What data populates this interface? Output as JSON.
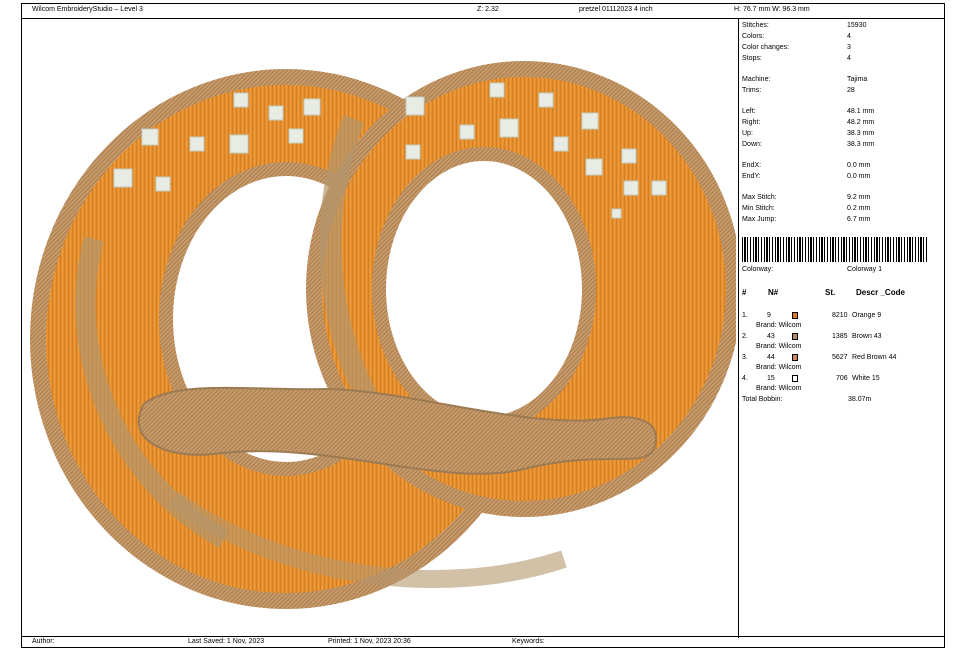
{
  "header": {
    "app_title": "Wilcom EmbroideryStudio – Level 3",
    "zoom": "Z: 2.32",
    "file": "pretzel 01112023 4 inch",
    "dims": "H: 76.7 mm   W: 96.3 mm"
  },
  "stats": {
    "stitches_label": "Stitches:",
    "stitches": "15930",
    "colors_label": "Colors:",
    "colors": "4",
    "color_changes_label": "Color changes:",
    "color_changes": "3",
    "stops_label": "Stops:",
    "stops": "4",
    "machine_label": "Machine:",
    "machine": "Tajima",
    "trims_label": "Trims:",
    "trims": "28",
    "left_label": "Left:",
    "left": "48.1 mm",
    "right_label": "Right:",
    "right": "48.2 mm",
    "up_label": "Up:",
    "up": "38.3 mm",
    "down_label": "Down:",
    "down": "38.3 mm",
    "endx_label": "EndX:",
    "endx": "0.0 mm",
    "endy_label": "EndY:",
    "endy": "0.0 mm",
    "max_stitch_label": "Max Stitch:",
    "max_stitch": "9.2 mm",
    "min_stitch_label": "Min Stitch:",
    "min_stitch": "0.2 mm",
    "max_jump_label": "Max Jump:",
    "max_jump": "6.7 mm"
  },
  "colorway": {
    "label": "Colorway:",
    "value": "Colorway 1"
  },
  "table": {
    "col_num": "#",
    "col_n": "N#",
    "col_st": "St.",
    "col_descr": "Descr _Code",
    "rows": [
      {
        "idx": "1.",
        "n": "9",
        "st": "8210",
        "descr": "Orange 9",
        "brand": "Brand: Wilcom",
        "color": "#e07b22"
      },
      {
        "idx": "2.",
        "n": "43",
        "st": "1385",
        "descr": "Brown 43",
        "brand": "Brand: Wilcom",
        "color": "#b08a66"
      },
      {
        "idx": "3.",
        "n": "44",
        "st": "5627",
        "descr": "Red Brown 44",
        "brand": "Brand: Wilcom",
        "color": "#c88a5e"
      },
      {
        "idx": "4.",
        "n": "15",
        "st": "706",
        "descr": "White 15",
        "brand": "Brand: Wilcom",
        "color": "#ffffff"
      }
    ],
    "total_label": "Total Bobbin:",
    "total_value": "38.07m"
  },
  "footer": {
    "author": "Author:",
    "last_saved": "Last Saved:  1 Nov, 2023",
    "printed": "Printed:  1 Nov, 2023 20:36",
    "keywords": "Keywords:"
  },
  "palette": {
    "orange": "#e58f2e",
    "rope": "#c79a6a",
    "shade": "#a98a62",
    "salt": "#e8ece4"
  }
}
